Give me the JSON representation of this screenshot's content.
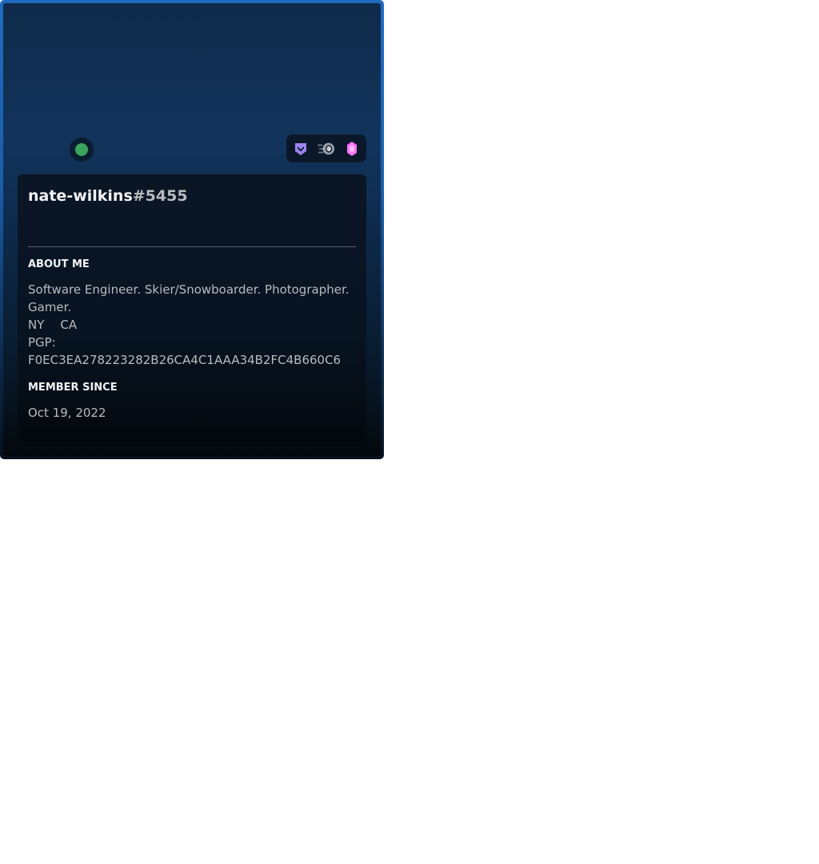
{
  "profile": {
    "username": "nate-wilkins",
    "discriminator": "#5455",
    "status": "online",
    "status_color": "#3ba55c",
    "accent_color": "#1f6bbf",
    "badges": [
      {
        "icon": "hypesquad-icon",
        "color": "#9c84ef"
      },
      {
        "icon": "nitro-icon",
        "color": "#b9bbbe"
      },
      {
        "icon": "boost-gem-icon",
        "color": "#ff73fa"
      }
    ],
    "about_title": "ABOUT ME",
    "about": {
      "line1": "Software Engineer. Skier/Snowboarder. Photographer.",
      "line2": "Gamer.",
      "loc_a": "NY",
      "loc_b": "CA",
      "pgp_label": "PGP:",
      "pgp_key": "F0EC3EA278223282B26CA4C1AAA34B2FC4B660C6"
    },
    "member_since_title": "MEMBER SINCE",
    "member_since": "Oct 19, 2022"
  }
}
